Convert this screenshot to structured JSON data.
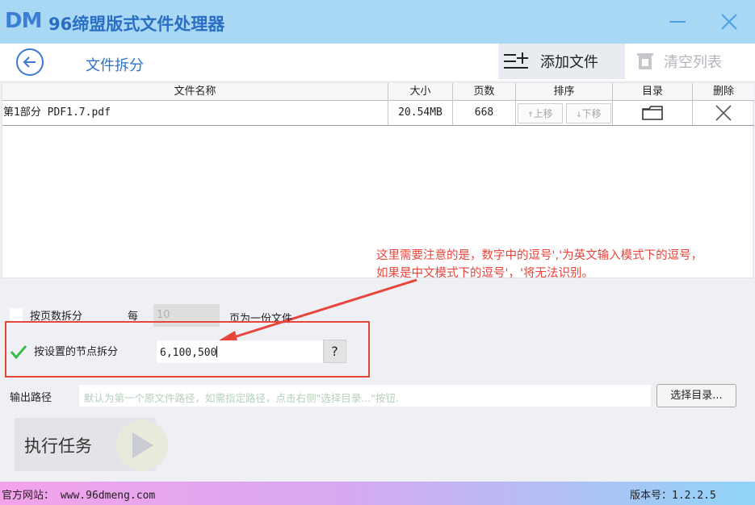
{
  "app": {
    "logo": "DM",
    "title": "96缔盟版式文件处理器"
  },
  "toolbar": {
    "page_name": "文件拆分",
    "add_label": "添加文件",
    "clear_label": "清空列表"
  },
  "table": {
    "headers": [
      "文件名称",
      "大小",
      "页数",
      "排序",
      "目录",
      "删除"
    ],
    "rows": [
      {
        "name": "第1部分 PDF1.7.pdf",
        "size": "20.54MB",
        "pages": "668",
        "up": "上移",
        "down": "下移"
      }
    ]
  },
  "options": {
    "by_pages": {
      "label": "按页数拆分",
      "every": "每",
      "value": "10",
      "suffix": "页为一份文件",
      "checked": false
    },
    "by_nodes": {
      "label": "按设置的节点拆分",
      "value": "6,100,500",
      "help": "?",
      "checked": true
    }
  },
  "annotation": {
    "line1": "这里需要注意的是，数字中的逗号','为英文输入模式下的逗号，",
    "line2": "如果是中文模式下的逗号'，'将无法识别。",
    "color": "#e8453c"
  },
  "output": {
    "label": "输出路径",
    "placeholder": "默认为第一个原文件路径，如需指定路径，点击右侧\"选择目录...\"按钮.",
    "browse_label": "选择目录..."
  },
  "run": {
    "label": "执行任务"
  },
  "status": {
    "website": "官方网站：  www.96dmeng.com",
    "version": "版本号：1.2.2.5"
  },
  "colors": {
    "titlebar": "#a9d8f4",
    "accent": "#2f73c9",
    "check": "#3dbb4a"
  }
}
